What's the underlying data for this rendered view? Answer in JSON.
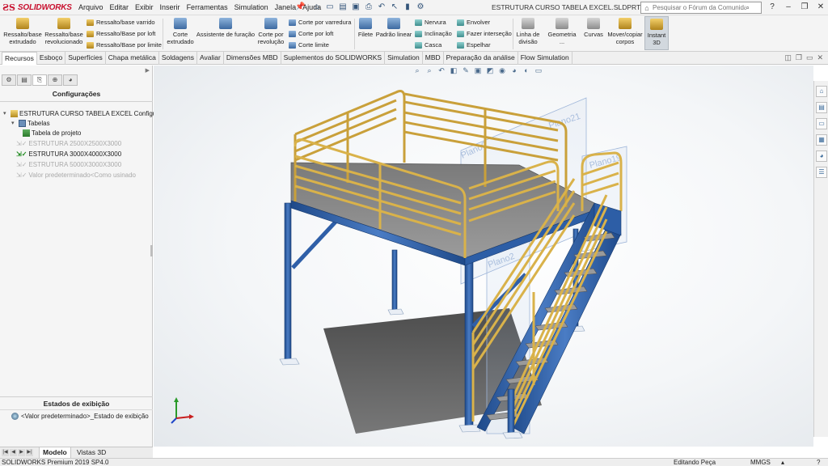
{
  "app": {
    "brand": "SOLIDWORKS",
    "document_title": "ESTRUTURA CURSO TABELA EXCEL.SLDPRT *",
    "search_placeholder": "Pesquisar o Fórum da Comunidade"
  },
  "menu": [
    "Arquivo",
    "Editar",
    "Exibir",
    "Inserir",
    "Ferramentas",
    "Simulation",
    "Janela",
    "Ajuda"
  ],
  "quick_access": [
    "home-icon",
    "new-icon",
    "open-icon",
    "save-icon",
    "print-icon",
    "undo-icon",
    "select-icon",
    "rebuild-icon",
    "options-icon"
  ],
  "ribbon": {
    "big": [
      {
        "label": "Ressalto/base\nextrudado",
        "color": "gold"
      },
      {
        "label": "Ressalto/base\nrevolucionado",
        "color": "gold"
      },
      {
        "label": "Corte\nextrudado",
        "color": "blue"
      },
      {
        "label": "Assistente de furação",
        "color": "blue"
      },
      {
        "label": "Corte por\nrevolução",
        "color": "blue"
      },
      {
        "label": "Filete",
        "color": "blue"
      },
      {
        "label": "Padrão linear",
        "color": "blue"
      },
      {
        "label": "Linha de\ndivisão",
        "color": "grey"
      },
      {
        "label": "Geometria\n...",
        "color": "grey"
      },
      {
        "label": "Curvas",
        "color": "grey"
      },
      {
        "label": "Mover/copiar\ncorpos",
        "color": "gold"
      },
      {
        "label": "Instant\n3D",
        "color": "gold"
      }
    ],
    "small_col1": [
      "Ressalto/base varrido",
      "Ressalto/Base por loft",
      "Ressalto/Base por limite"
    ],
    "small_col2": [
      "Corte por varredura",
      "Corte por loft",
      "Corte limite"
    ],
    "small_col3": [
      "Nervura",
      "Inclinação",
      "Casca"
    ],
    "small_col4": [
      "Envolver",
      "Fazer interseção",
      "Espelhar"
    ]
  },
  "tabs": [
    "Recursos",
    "Esboço",
    "Superfícies",
    "Chapa metálica",
    "Soldagens",
    "Avaliar",
    "Dimensões MBD",
    "Suplementos do SOLIDWORKS",
    "Simulation",
    "MBD",
    "Preparação da análise",
    "Flow Simulation"
  ],
  "active_tab": "Recursos",
  "left_panel": {
    "title": "Configurações",
    "root": "ESTRUTURA CURSO TABELA EXCEL Configura",
    "tables_node": "Tabelas",
    "design_table": "Tabela de projeto",
    "configs": [
      {
        "name": "ESTRUTURA 2500X2500X3000",
        "active": false
      },
      {
        "name": "ESTRUTURA 3000X4000X3000",
        "active": true
      },
      {
        "name": "ESTRUTURA 5000X3000X3000",
        "active": false
      },
      {
        "name": "Valor predeterminado<Como usinado",
        "active": false
      }
    ],
    "display_states_title": "Estados de exibição",
    "display_state_item": "<Valor predeterminado>_Estado de exibição"
  },
  "bottom_tabs": [
    "Modelo",
    "Vistas 3D"
  ],
  "status": {
    "version": "SOLIDWORKS Premium 2019 SP4.0",
    "mode": "Editando Peça",
    "units": "MMGS"
  },
  "planes": [
    "Plano21",
    "Plano19",
    "Plano9",
    "Plano2"
  ],
  "colors": {
    "frame_blue": "#2f5fa8",
    "rail_gold": "#d9b24a",
    "deck_grey": "#8a8a8a",
    "brand_red": "#c8102e"
  }
}
